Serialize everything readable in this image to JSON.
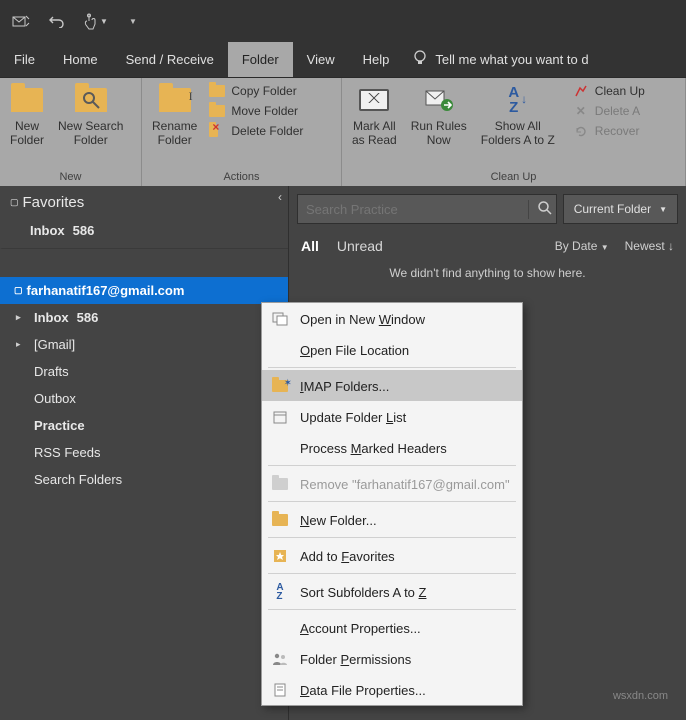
{
  "qat": {
    "undo_tip": "Undo",
    "touch_tip": "Touch/Mouse mode"
  },
  "menubar": {
    "file": "File",
    "home": "Home",
    "send_receive": "Send / Receive",
    "folder": "Folder",
    "view": "View",
    "help": "Help",
    "tell_me": "Tell me what you want to d"
  },
  "ribbon": {
    "group_new": {
      "label": "New",
      "new_folder": "New\nFolder",
      "new_search_folder": "New Search\nFolder"
    },
    "group_actions": {
      "label": "Actions",
      "rename_folder": "Rename\nFolder",
      "copy": "Copy Folder",
      "move": "Move Folder",
      "delete": "Delete Folder"
    },
    "group_cleanup": {
      "label": "Clean Up",
      "mark_all": "Mark All\nas Read",
      "run_rules": "Run Rules\nNow",
      "show_all": "Show All\nFolders A to Z",
      "clean_up": "Clean Up",
      "delete_all": "Delete A",
      "recover": "Recover"
    }
  },
  "nav": {
    "favorites_label": "Favorites",
    "fav_inbox": "Inbox",
    "fav_inbox_count": "586",
    "account": "farhanatif167@gmail.com",
    "items": [
      {
        "label": "Inbox",
        "count": "586",
        "bold": true,
        "expand": "▸"
      },
      {
        "label": "[Gmail]",
        "count": "",
        "bold": false,
        "expand": "▸"
      },
      {
        "label": "Drafts",
        "count": "",
        "bold": false,
        "expand": ""
      },
      {
        "label": "Outbox",
        "count": "",
        "bold": false,
        "expand": ""
      },
      {
        "label": "Practice",
        "count": "",
        "bold": true,
        "expand": ""
      },
      {
        "label": "RSS Feeds",
        "count": "",
        "bold": false,
        "expand": ""
      },
      {
        "label": "Search Folders",
        "count": "",
        "bold": false,
        "expand": ""
      }
    ]
  },
  "reading": {
    "search_placeholder": "Search Practice",
    "scope": "Current Folder",
    "filter_all": "All",
    "filter_unread": "Unread",
    "sort_by": "By Date",
    "sort_order": "Newest",
    "empty": "We didn't find anything to show here."
  },
  "context_menu": {
    "open_new_window": "Open in New Window",
    "open_file_location": "Open File Location",
    "imap_folders": "IMAP Folders...",
    "update_folder_list": "Update Folder List",
    "process_marked": "Process Marked Headers",
    "remove": "Remove \"farhanatif167@gmail.com\"",
    "new_folder": "New Folder...",
    "add_favorites": "Add to Favorites",
    "sort_subfolders": "Sort Subfolders A to Z",
    "account_properties": "Account Properties...",
    "folder_permissions": "Folder Permissions",
    "data_file_properties": "Data File Properties..."
  },
  "watermark": "wsxdn.com"
}
